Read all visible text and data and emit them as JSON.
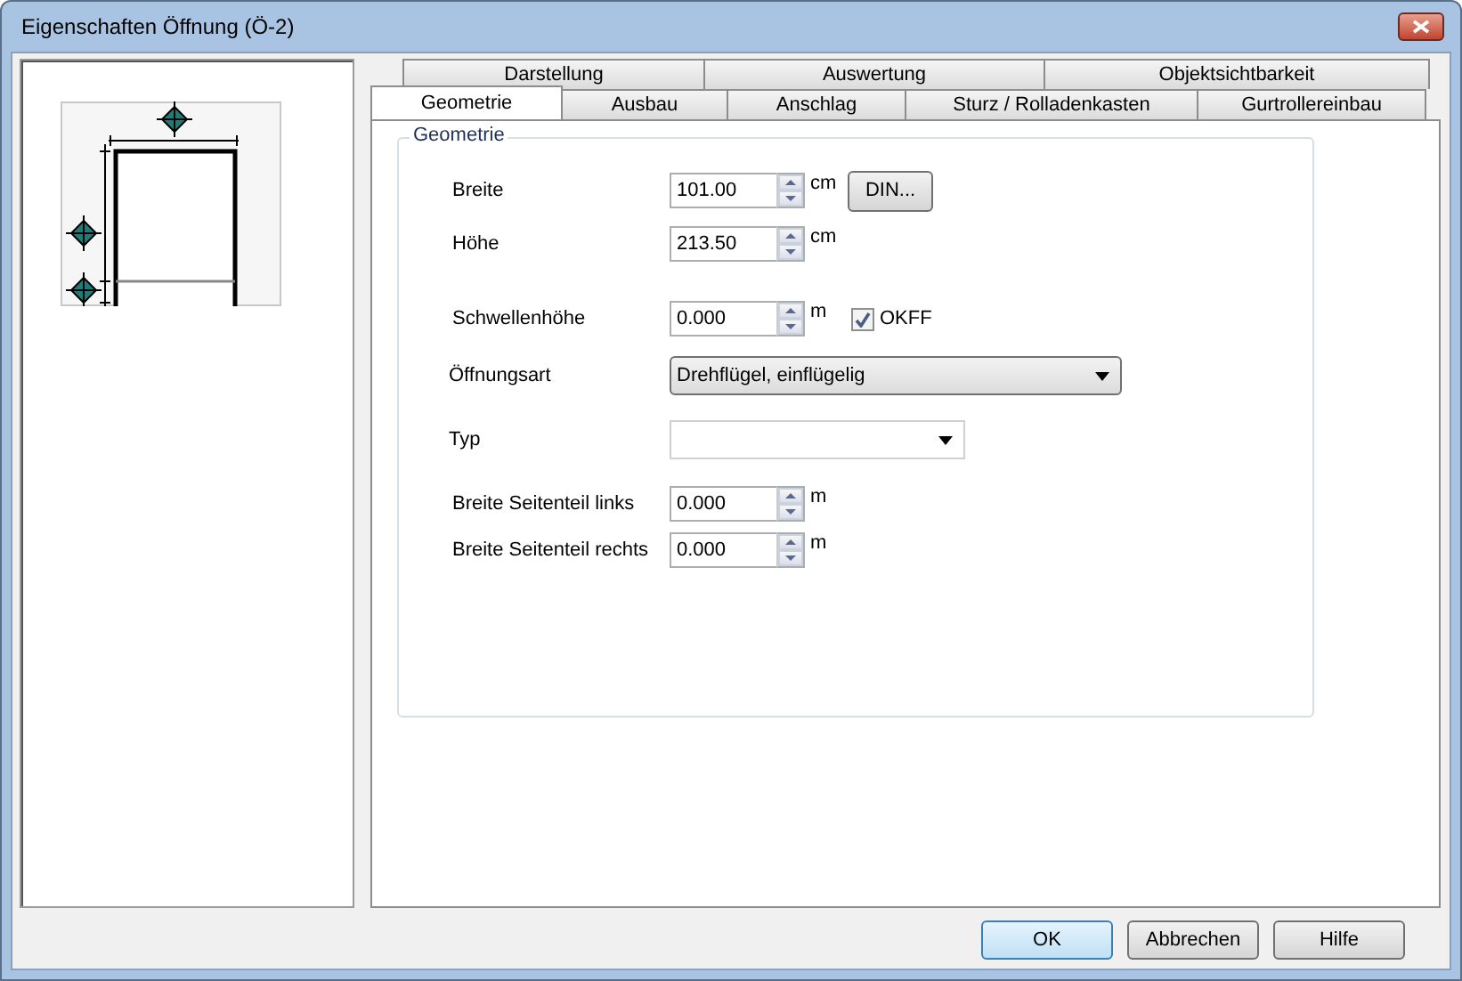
{
  "window": {
    "title": "Eigenschaften Öffnung (Ö-2)"
  },
  "tab_rows": [
    [
      {
        "label": "Darstellung",
        "selected": false
      },
      {
        "label": "Auswertung",
        "selected": false
      },
      {
        "label": "Objektsichtbarkeit",
        "selected": false
      }
    ],
    [
      {
        "label": "Geometrie",
        "selected": true
      },
      {
        "label": "Ausbau",
        "selected": false
      },
      {
        "label": "Anschlag",
        "selected": false
      },
      {
        "label": "Sturz / Rolladenkasten",
        "selected": false
      },
      {
        "label": "Gurtrollereinbau",
        "selected": false
      }
    ]
  ],
  "group": {
    "title": "Geometrie",
    "fields": [
      {
        "kind": "spin",
        "label": "Breite",
        "value": "101.00",
        "unit": "cm",
        "button": "DIN..."
      },
      {
        "kind": "spin",
        "label": "Höhe",
        "value": "213.50",
        "unit": "cm"
      },
      {
        "kind": "spin",
        "label": "Schwellenhöhe",
        "value": "0.000",
        "unit": "m",
        "checkbox": {
          "label": "OKFF",
          "checked": true
        }
      },
      {
        "kind": "select",
        "label": "Öffnungsart",
        "value": "Drehflügel, einflügelig"
      },
      {
        "kind": "combo",
        "label": "Typ"
      },
      {
        "kind": "spin",
        "label": "Breite Seitenteil links",
        "value": "0.000",
        "unit": "m"
      },
      {
        "kind": "spin",
        "label": "Breite Seitenteil rechts",
        "value": "0.000",
        "unit": "m"
      }
    ]
  },
  "buttons": [
    {
      "label": "OK",
      "default": true
    },
    {
      "label": "Abbrechen",
      "default": false
    },
    {
      "label": "Hilfe",
      "default": false
    }
  ]
}
